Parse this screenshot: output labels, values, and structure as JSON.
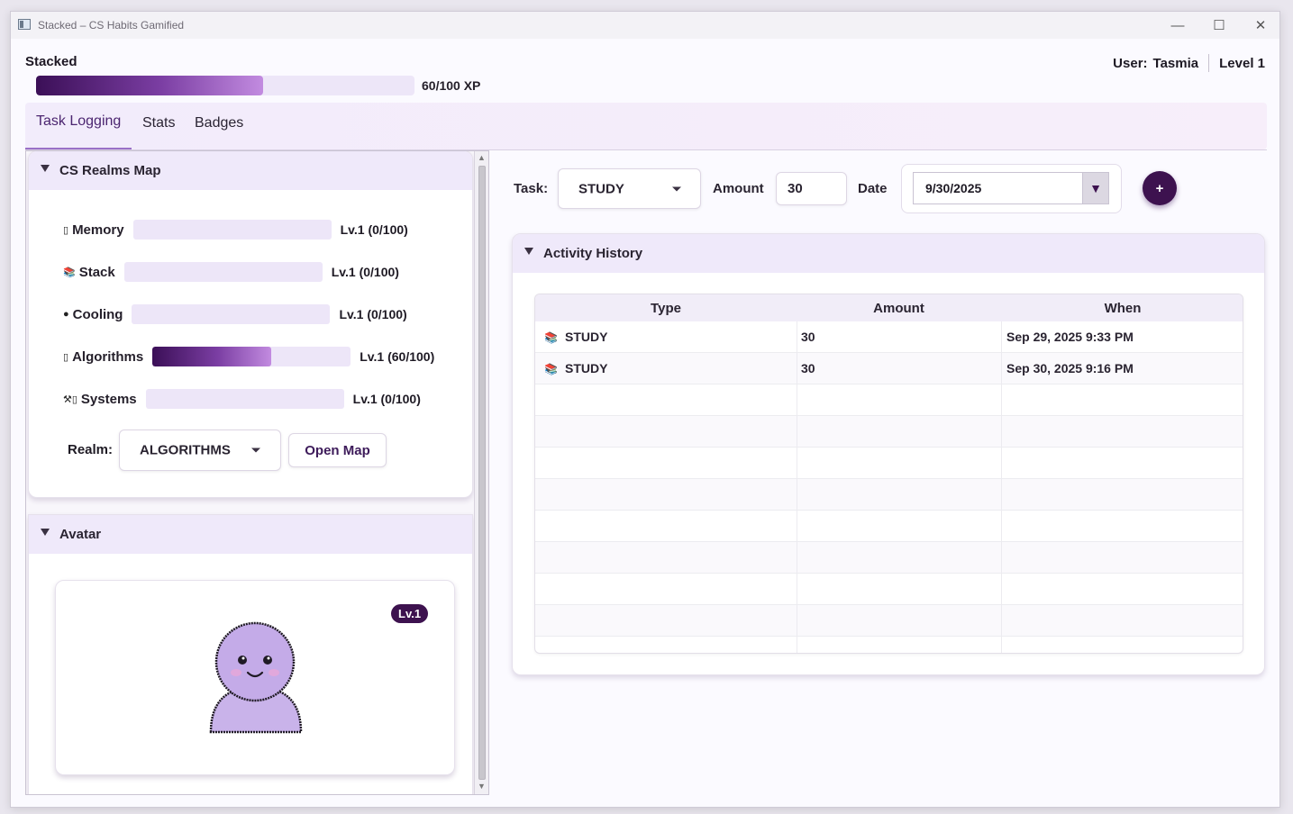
{
  "window": {
    "title": "Stacked – CS Habits Gamified",
    "minimize": "—",
    "maximize": "☐",
    "close": "✕"
  },
  "header": {
    "app_name": "Stacked",
    "xp": {
      "current": 60,
      "max": 100,
      "text": "60/100 XP"
    },
    "user_label": "User:",
    "user_name": "Tasmia",
    "level": "Level 1"
  },
  "tabs": [
    {
      "label": "Task Logging",
      "active": true
    },
    {
      "label": "Stats",
      "active": false
    },
    {
      "label": "Badges",
      "active": false
    }
  ],
  "realms_card": {
    "title": "CS Realms Map",
    "realms": [
      {
        "icon": "memory-icon",
        "glyph": "▯",
        "name": "Memory",
        "progress": 0,
        "level_text": "Lv.1 (0/100)"
      },
      {
        "icon": "books-icon",
        "glyph": "📚",
        "name": "Stack",
        "progress": 0,
        "level_text": "Lv.1 (0/100)"
      },
      {
        "icon": "droplet-icon",
        "glyph": "●",
        "name": "Cooling",
        "progress": 0,
        "level_text": "Lv.1 (0/100)"
      },
      {
        "icon": "algorithm-icon",
        "glyph": "▯",
        "name": "Algorithms",
        "progress": 0.6,
        "level_text": "Lv.1 (60/100)"
      },
      {
        "icon": "tools-icon",
        "glyph": "⚒▯",
        "name": "Systems",
        "progress": 0,
        "level_text": "Lv.1 (0/100)"
      }
    ],
    "realm_label": "Realm:",
    "realm_selected": "ALGORITHMS",
    "open_map": "Open Map"
  },
  "avatar_card": {
    "title": "Avatar",
    "level_badge": "Lv.1"
  },
  "task_form": {
    "task_label": "Task:",
    "task_value": "STUDY",
    "amount_label": "Amount",
    "amount_value": "30",
    "date_label": "Date",
    "date_value": "9/30/2025",
    "date_button": "▼",
    "add_button": "+"
  },
  "activity": {
    "title": "Activity History",
    "columns": [
      "Type",
      "Amount",
      "When"
    ],
    "rows": [
      {
        "type": "STUDY",
        "amount": "30",
        "when": "Sep 29, 2025 9:33 PM"
      },
      {
        "type": "STUDY",
        "amount": "30",
        "when": "Sep 30, 2025 9:16 PM"
      }
    ]
  }
}
